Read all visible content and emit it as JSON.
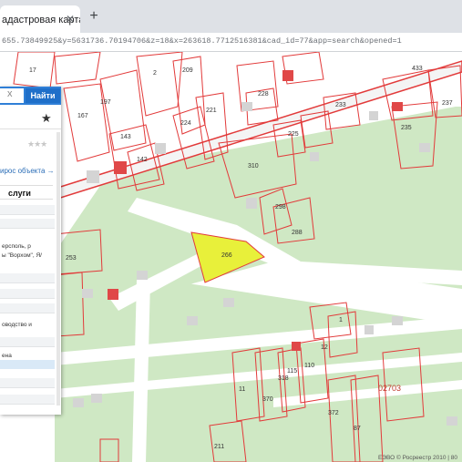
{
  "browser": {
    "tab_title": "адастровая карта",
    "tab_close": "✕",
    "new_tab": "+",
    "url": "655.73849925&y=5631736.70194706&z=18&x=263618.7712516381&cad_id=77&app=search&opened=1"
  },
  "panel": {
    "search_clear": "x",
    "search_button": "Найти",
    "star": "★",
    "rating": "★★★",
    "link": "ирос объекта →",
    "section_title": "слуги",
    "address_line1": "ерсполь, р",
    "address_line2": "ы \"Ворхом\", Я/",
    "activity_line": "оводство и",
    "status_line": "ена"
  },
  "map": {
    "parcels": [
      {
        "label": "17"
      },
      {
        "label": "209"
      },
      {
        "label": "167"
      },
      {
        "label": "197"
      },
      {
        "label": "224"
      },
      {
        "label": "221"
      },
      {
        "label": "143"
      },
      {
        "label": "142"
      },
      {
        "label": "2"
      },
      {
        "label": "233"
      },
      {
        "label": "225"
      },
      {
        "label": "310"
      },
      {
        "label": "298"
      },
      {
        "label": "288"
      },
      {
        "label": "266"
      },
      {
        "label": "253"
      },
      {
        "label": "228"
      },
      {
        "label": "237"
      },
      {
        "label": "235"
      },
      {
        "label": "433"
      },
      {
        "label": "1"
      },
      {
        "label": "11"
      },
      {
        "label": "115"
      },
      {
        "label": "370"
      },
      {
        "label": "87"
      },
      {
        "label": "12"
      },
      {
        "label": "372"
      },
      {
        "label": "318"
      },
      {
        "label": "110"
      },
      {
        "label": "211"
      }
    ],
    "zone_label": "02703",
    "copyright": "ЕЭВО © Росреестр 2010 | 80",
    "colors": {
      "parcel_border": "#e23a3a",
      "highlight": "#e8f03a",
      "green": "#cfe8c4",
      "road": "#ffffff"
    }
  }
}
